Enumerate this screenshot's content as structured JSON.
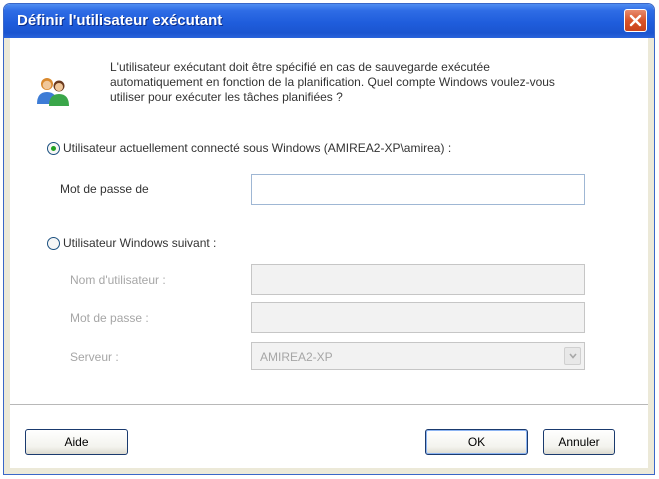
{
  "dialog": {
    "title": "Définir l'utilisateur exécutant",
    "intro": "L'utilisateur exécutant doit être spécifié en cas de sauvegarde exécutée automatiquement en fonction de la planification. Quel compte Windows voulez-vous utiliser pour exécuter les tâches planifiées ?"
  },
  "option_current": {
    "label": "Utilisateur actuellement connecté sous Windows (AMIREA2-XP\\amirea) :",
    "selected": true,
    "password_label": "Mot de passe de",
    "password_value": ""
  },
  "option_other": {
    "label": "Utilisateur Windows suivant :",
    "selected": false,
    "username_label": "Nom d'utilisateur :",
    "username_value": "",
    "password_label": "Mot de passe :",
    "password_value": "",
    "server_label": "Serveur :",
    "server_value": "AMIREA2-XP"
  },
  "buttons": {
    "help": "Aide",
    "ok": "OK",
    "cancel": "Annuler"
  },
  "icons": {
    "close": "close-icon",
    "users": "users-icon",
    "dropdown": "chevron-down-icon"
  },
  "colors": {
    "titlebar": "#1f5ddc",
    "close_button": "#d9542a",
    "radio_dot": "#21a121",
    "dialog_background": "#ece9d8"
  }
}
